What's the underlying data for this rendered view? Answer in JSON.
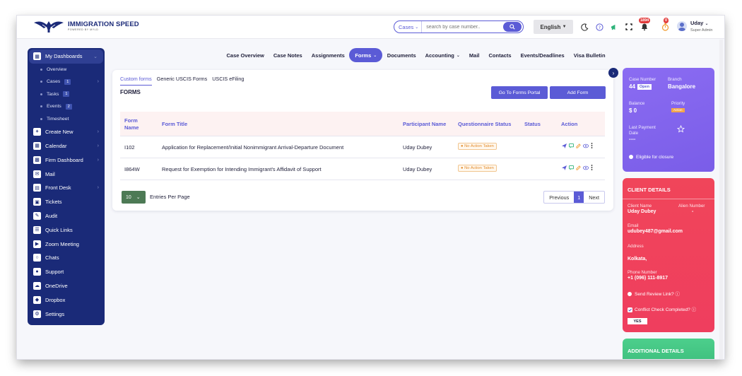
{
  "brand": {
    "name": "IMMIGRATION SPEED",
    "tagline": "POWERED BY MYLD"
  },
  "search": {
    "scope": "Cases",
    "placeholder": "search by case number.."
  },
  "language": {
    "label": "English"
  },
  "notifications": {
    "count": "1894",
    "timer_badge": "0"
  },
  "user": {
    "name": "Uday",
    "role": "Super Admin"
  },
  "sidebar": {
    "dashboard": "My Dashboards",
    "sub_items": [
      {
        "label": "Overview",
        "count": ""
      },
      {
        "label": "Cases",
        "count": "1"
      },
      {
        "label": "Tasks",
        "count": "1"
      },
      {
        "label": "Events",
        "count": "2"
      },
      {
        "label": "Timesheet",
        "count": ""
      }
    ],
    "items": [
      {
        "label": "Create New",
        "arrow": true
      },
      {
        "label": "Calendar",
        "arrow": true
      },
      {
        "label": "Firm Dashboard",
        "arrow": true
      },
      {
        "label": "Mail",
        "arrow": false
      },
      {
        "label": "Front Desk",
        "arrow": true
      },
      {
        "label": "Tickets",
        "arrow": false
      },
      {
        "label": "Audit",
        "arrow": false
      },
      {
        "label": "Quick Links",
        "arrow": false
      },
      {
        "label": "Zoom Meeting",
        "arrow": false
      },
      {
        "label": "Chats",
        "arrow": false
      },
      {
        "label": "Support",
        "arrow": false
      },
      {
        "label": "OneDrive",
        "arrow": false
      },
      {
        "label": "Dropbox",
        "arrow": false
      },
      {
        "label": "Settings",
        "arrow": false
      }
    ]
  },
  "tabs": [
    "Case Overview",
    "Case Notes",
    "Assignments",
    "Forms",
    "Documents",
    "Accounting",
    "Mail",
    "Contacts",
    "Events/Deadlines",
    "Visa Bulletin"
  ],
  "forms": {
    "subtabs": [
      "Custom forms",
      "Generic USCIS Forms",
      "USCIS eFiling"
    ],
    "title": "FORMS",
    "portal_button": "Go To Forms Portal",
    "add_button": "Add Form",
    "columns": [
      "Form Name",
      "Form Title",
      "Participant Name",
      "Questionnaire Status",
      "Status",
      "Action"
    ],
    "rows": [
      {
        "name": "I102",
        "title": "Application for Replacement/Initial Nonimmigrant Arrival-Departure Document",
        "participant": "Uday Dubey",
        "questionnaire": "No Action Taken",
        "status": ""
      },
      {
        "name": "I864W",
        "title": "Request for Exemption for Intending Immigrant's Affidavit of Support",
        "participant": "Uday Dubey",
        "questionnaire": "No Action Taken",
        "status": ""
      }
    ],
    "entries_value": "10",
    "entries_label": "Entries Per Page",
    "pager": {
      "prev": "Previous",
      "current": "1",
      "next": "Next"
    }
  },
  "case": {
    "case_number_label": "Case Number",
    "case_number": "44",
    "case_status": "Open",
    "branch_label": "Branch",
    "branch": "Bangalore",
    "balance_label": "Balance",
    "balance": "$ 0",
    "priority_label": "Priority",
    "priority": "Action",
    "last_payment_label": "Last Payment Date",
    "last_payment": "----",
    "closure_label": "Eligible for closure"
  },
  "client": {
    "title": "CLIENT DETAILS",
    "name_label": "Client Name",
    "name": "Uday Dubey",
    "alien_label": "Alien Number",
    "alien": "-",
    "email_label": "Email",
    "email": "udubey487@gmail.com",
    "address_label": "Address",
    "address": "Kolkata,",
    "phone_label": "Phone Number",
    "phone": "+1 (096) 111-8917",
    "review_label": "Send Review Link?",
    "conflict_label": "Conflict Check Completed?",
    "conflict_value": "YES"
  },
  "additional": {
    "title": "ADDITIONAL DETAILS"
  },
  "colors": {
    "primary": "#5b5bd6",
    "sidebar": "#1a2a78",
    "case_card": "#8b6cf2",
    "client_card": "#f0455a",
    "additional_card": "#4ccf8c"
  }
}
